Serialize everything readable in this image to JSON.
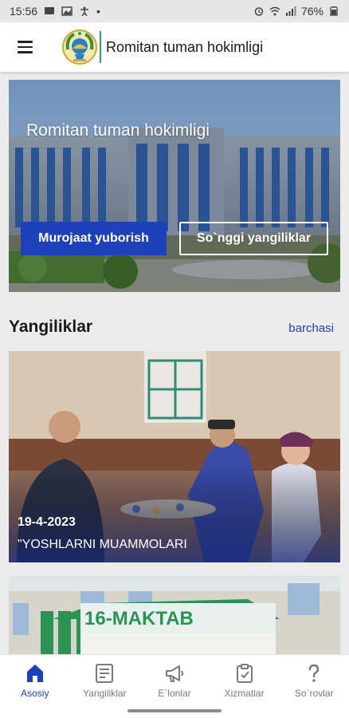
{
  "status_bar": {
    "time": "15:56",
    "battery": "76%",
    "dot": "•"
  },
  "app_bar": {
    "title": "Romitan tuman hokimligi"
  },
  "hero": {
    "title": "Romitan tuman hokimligi",
    "primary_button": "Murojaat yuborish",
    "secondary_button": "So`nggi yangiliklar"
  },
  "news_section": {
    "title": "Yangiliklar",
    "see_all": "barchasi",
    "items": [
      {
        "date": "19-4-2023",
        "title": "\"YOSHLARNI MUAMMOLARI"
      },
      {
        "sign": "16-MAKTAB"
      }
    ]
  },
  "bottom_nav": {
    "items": [
      {
        "label": "Asosiy",
        "icon": "home-icon",
        "active": true
      },
      {
        "label": "Yangiliklar",
        "icon": "news-icon",
        "active": false
      },
      {
        "label": "E`lonlar",
        "icon": "megaphone-icon",
        "active": false
      },
      {
        "label": "Xizmatlar",
        "icon": "clipboard-icon",
        "active": false
      },
      {
        "label": "So`rovlar",
        "icon": "question-icon",
        "active": false
      }
    ]
  },
  "colors": {
    "accent": "#1e40b8",
    "inactive": "#7a7a7a"
  }
}
